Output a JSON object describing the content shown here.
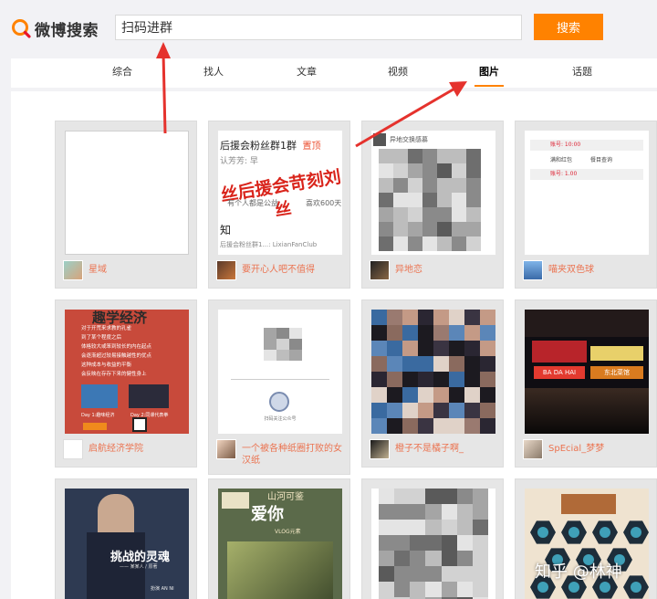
{
  "header": {
    "logo_text": "微博搜索",
    "search_value": "扫码进群",
    "search_button": "搜索"
  },
  "tabs": [
    "综合",
    "找人",
    "文章",
    "视频",
    "图片",
    "话题"
  ],
  "active_tab": "图片",
  "cards": [
    {
      "owner": "星域"
    },
    {
      "owner": "要开心人吧不值得"
    },
    {
      "owner": "异地恋"
    },
    {
      "owner": "喵夹双色球"
    },
    {
      "owner": "启航经济学院"
    },
    {
      "owner": "一个被各种纸圈打败的女汉纸"
    },
    {
      "owner": "橙子不是橘子啊_"
    },
    {
      "owner": "SpEcial_梦梦"
    },
    {
      "owner": ""
    },
    {
      "owner": ""
    },
    {
      "owner": ""
    },
    {
      "owner": ""
    }
  ],
  "card2": {
    "line1": "后援会粉丝群1群",
    "tag": "置顶",
    "line2": "认芳芳: 早",
    "overlay": "丝后援会苛刻刘",
    "overlay2": "丝",
    "line3": "有个人都是公益",
    "line4": "喜欢600天",
    "line5": "知",
    "line6": "后援会粉丝群1...: LixianFanClub"
  },
  "card3": {
    "header": "异地交换感慕"
  },
  "card4": {
    "row1": "账号: 10:00",
    "row2a": "满和红包",
    "row2b": "餐目查询",
    "row3": "账号: 1.00"
  },
  "card5": {
    "title": "趣学经济",
    "lines": [
      "对于开荒来求教的孔雀",
      "到了某个程度之后",
      "体格较大或笨到较长的内在起点",
      "会逐渐超过较易接触越性的优点",
      "这种成本与收益的平衡",
      "会反映在存存下来的健性身上"
    ],
    "cap1": "Day 1:趣味经济",
    "cap2": "Day 2:同课代表拳"
  },
  "card6": {
    "caption": "扫码关注公众号"
  },
  "card8": {
    "sign1": "BA DA HAI",
    "sign2": "东北菜馆"
  },
  "card9": {
    "title": "挑战的灵魂",
    "sub": "—— 某某人 / 原著",
    "cast": "扮演 AN NI"
  },
  "card10": {
    "title": "爱你",
    "sub": "山河可鉴",
    "tag": "VLOG元素"
  },
  "watermark": "知乎 @林神",
  "colors": {
    "accent": "#ff8200",
    "owner_text": "#eb7350",
    "annotation": "#e5322d"
  }
}
